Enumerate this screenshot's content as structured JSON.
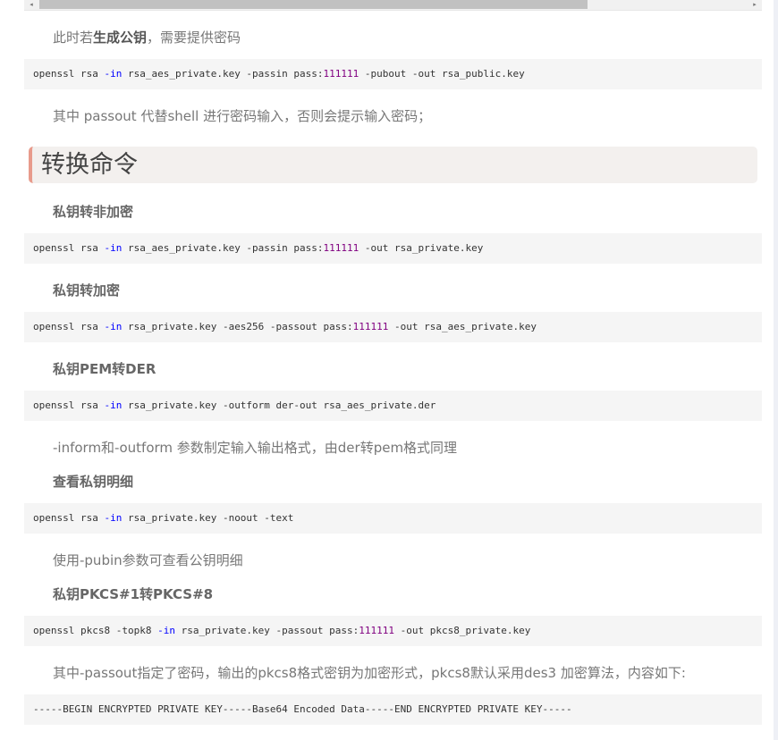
{
  "scrollbar": {
    "left_arrow": "◂",
    "right_arrow": "▸"
  },
  "intro": {
    "prefix": "此时若",
    "bold": "生成公钥",
    "suffix": "，需要提供密码"
  },
  "code1": {
    "a": "openssl rsa ",
    "kw": "-in",
    "b": " rsa_aes_private.key -passin pass:",
    "num": "111111",
    "c": " -pubout -out rsa_public.key"
  },
  "note1": "其中 passout 代替shell 进行密码输入，否则会提示输入密码；",
  "section_title": "转换命令",
  "sub1": "私钥转非加密",
  "code2": {
    "a": "openssl rsa ",
    "kw": "-in",
    "b": " rsa_aes_private.key -passin pass:",
    "num": "111111",
    "c": " -out rsa_private.key"
  },
  "sub2": "私钥转加密",
  "code3": {
    "a": "openssl rsa ",
    "kw": "-in",
    "b": " rsa_private.key -aes256 -passout pass:",
    "num": "111111",
    "c": " -out rsa_aes_private.key"
  },
  "sub3": "私钥PEM转DER",
  "code4": {
    "a": "openssl rsa ",
    "kw": "-in",
    "b": " rsa_private.key -outform der-out rsa_aes_private.der"
  },
  "note2": "-inform和-outform 参数制定输入输出格式，由der转pem格式同理",
  "sub4": "查看私钥明细",
  "code5": {
    "a": "openssl rsa ",
    "kw": "-in",
    "b": " rsa_private.key -noout -text"
  },
  "note3": "使用-pubin参数可查看公钥明细",
  "sub5": "私钥PKCS#1转PKCS#8",
  "code6": {
    "a": "openssl pkcs8 -topk8 ",
    "kw": "-in",
    "b": " rsa_private.key -passout pass:",
    "num": "111111",
    "c": " -out pkcs8_private.key"
  },
  "note4": "其中-passout指定了密码，输出的pkcs8格式密钥为加密形式，pkcs8默认采用des3 加密算法，内容如下:",
  "code7": {
    "a": "-----BEGIN ENCRYPTED PRIVATE KEY-----Base64 Encoded Data-----END ENCRYPTED PRIVATE KEY-----"
  }
}
